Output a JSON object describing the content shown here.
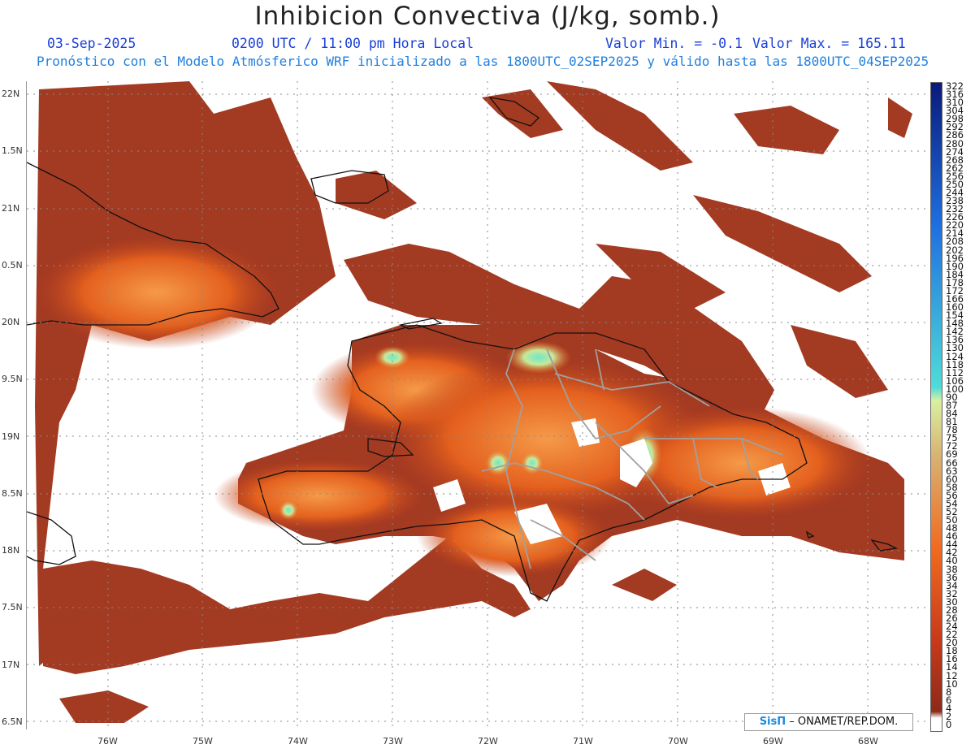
{
  "title": "Inhibicion Convectiva (J/kg, somb.)",
  "header": {
    "date": "03-Sep-2025",
    "time": "0200 UTC / 11:00 pm Hora Local",
    "valor_min": "Valor Min. = -0.1",
    "valor_max": "Valor Max. = 165.11",
    "subtitle": "Pronóstico con el Modelo Atmósferico WRF inicializado a las 1800UTC_02SEP2025 y válido hasta las  1800UTC_04SEP2025"
  },
  "axes": {
    "lat_labels": [
      "22N",
      "1.5N",
      "21N",
      "0.5N",
      "20N",
      "9.5N",
      "19N",
      "8.5N",
      "18N",
      "7.5N",
      "17N",
      "6.5N"
    ],
    "lon_labels": [
      "76W",
      "75W",
      "74W",
      "73W",
      "72W",
      "71W",
      "70W",
      "69W",
      "68W"
    ],
    "lat_range": [
      6.5,
      22
    ],
    "lon_range": [
      -76.8,
      -67.4
    ]
  },
  "colorbar": {
    "labels": [
      "322",
      "316",
      "310",
      "304",
      "298",
      "292",
      "286",
      "280",
      "274",
      "268",
      "262",
      "256",
      "250",
      "244",
      "238",
      "232",
      "226",
      "220",
      "214",
      "208",
      "202",
      "196",
      "190",
      "184",
      "178",
      "172",
      "166",
      "160",
      "154",
      "148",
      "142",
      "136",
      "130",
      "124",
      "118",
      "112",
      "106",
      "100",
      "90",
      "87",
      "84",
      "81",
      "78",
      "75",
      "72",
      "69",
      "66",
      "63",
      "60",
      "58",
      "56",
      "54",
      "52",
      "50",
      "48",
      "46",
      "44",
      "42",
      "40",
      "38",
      "36",
      "34",
      "32",
      "30",
      "28",
      "26",
      "24",
      "22",
      "20",
      "18",
      "16",
      "14",
      "12",
      "10",
      "8",
      "6",
      "4",
      "2",
      "0"
    ],
    "colors": {
      "high": "#0a1a7a",
      "blue": "#1f6fe0",
      "cyan": "#4fdcd8",
      "lightgreen": "#d8f0a0",
      "tan": "#d8b070",
      "orange": "#f06a20",
      "red": "#c83a1a",
      "darkred": "#8c2a1a",
      "zero": "#ffffff"
    }
  },
  "credit": {
    "brand": "SisΠ",
    "text": "– ONAMET/REP.DOM."
  },
  "colors": {
    "field_base": "#a33a22",
    "field_mid": "#d4501e",
    "field_hot": "#f07a28",
    "field_peak": "#7fe0c0",
    "coast": "#111111",
    "provinces": "#a0a0a0",
    "grid": "#888888"
  }
}
